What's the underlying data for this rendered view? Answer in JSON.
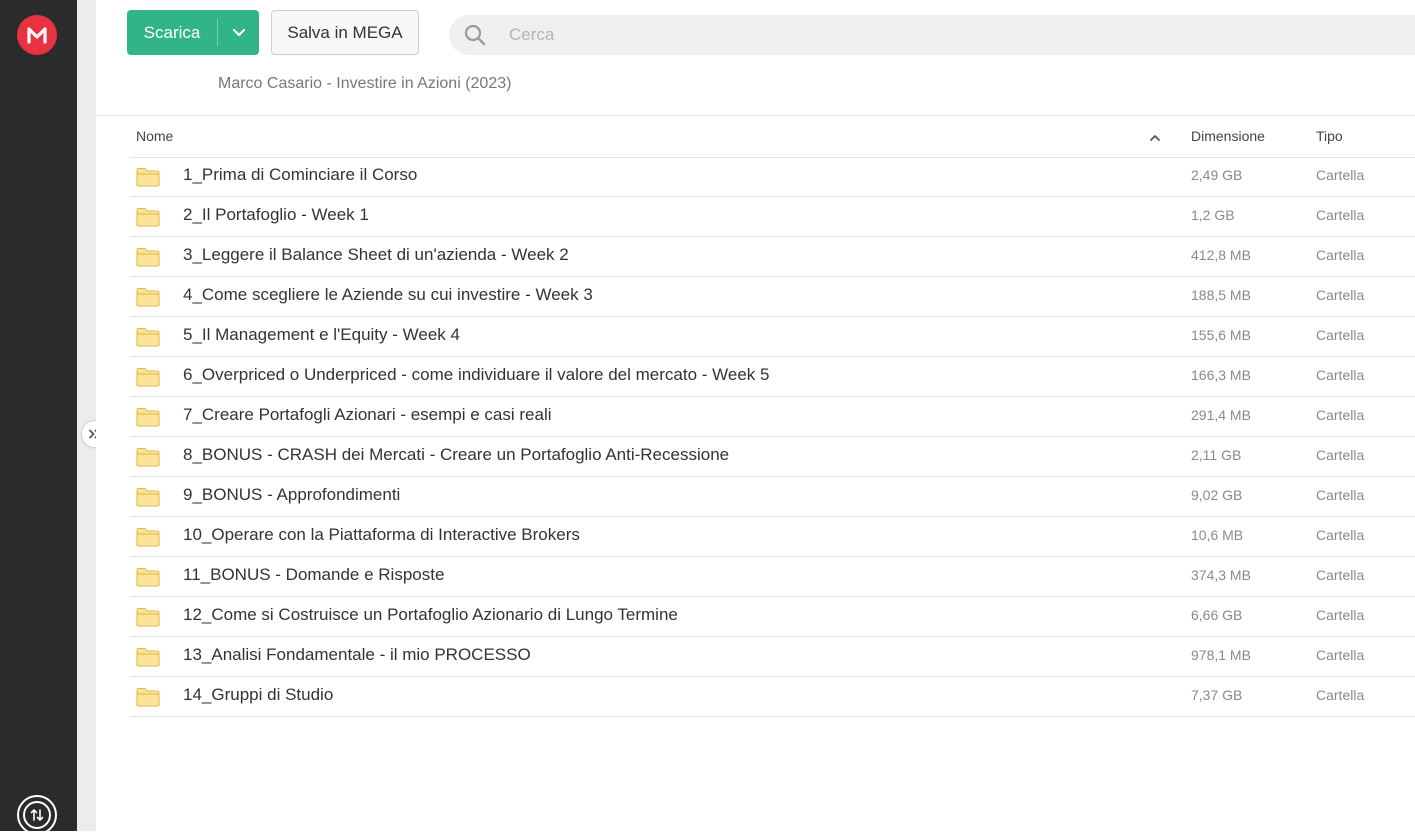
{
  "app": {
    "logo_icon": "mega-logo-icon",
    "brand_color": "#e8323f",
    "accent_color": "#31b487"
  },
  "toolbar": {
    "download_label": "Scarica",
    "save_label": "Salva in MEGA",
    "search_placeholder": "Cerca"
  },
  "breadcrumb": {
    "path": "Marco Casario - Investire in Azioni (2023)"
  },
  "table": {
    "columns": {
      "name": "Nome",
      "size": "Dimensione",
      "type": "Tipo"
    },
    "sort": "name-ascending",
    "rows": [
      {
        "name": "1_Prima di Cominciare il Corso",
        "size": "2,49 GB",
        "type": "Cartella"
      },
      {
        "name": "2_Il Portafoglio - Week 1",
        "size": "1,2 GB",
        "type": "Cartella"
      },
      {
        "name": "3_Leggere il Balance Sheet di un'azienda - Week 2",
        "size": "412,8 MB",
        "type": "Cartella"
      },
      {
        "name": "4_Come scegliere le Aziende su cui investire - Week 3",
        "size": "188,5 MB",
        "type": "Cartella"
      },
      {
        "name": "5_Il Management e l'Equity - Week 4",
        "size": "155,6 MB",
        "type": "Cartella"
      },
      {
        "name": "6_Overpriced o Underpriced - come individuare il valore del mercato - Week 5",
        "size": "166,3 MB",
        "type": "Cartella"
      },
      {
        "name": "7_Creare Portafogli Azionari - esempi e casi reali",
        "size": "291,4 MB",
        "type": "Cartella"
      },
      {
        "name": "8_BONUS - CRASH dei Mercati - Creare un Portafoglio Anti-Recessione",
        "size": "2,11 GB",
        "type": "Cartella"
      },
      {
        "name": "9_BONUS - Approfondimenti",
        "size": "9,02 GB",
        "type": "Cartella"
      },
      {
        "name": "10_Operare con la Piattaforma di Interactive Brokers",
        "size": "10,6 MB",
        "type": "Cartella"
      },
      {
        "name": "11_BONUS - Domande e Risposte",
        "size": "374,3 MB",
        "type": "Cartella"
      },
      {
        "name": "12_Come si Costruisce un Portafoglio Azionario di Lungo Termine",
        "size": "6,66 GB",
        "type": "Cartella"
      },
      {
        "name": "13_Analisi Fondamentale - il mio PROCESSO",
        "size": "978,1 MB",
        "type": "Cartella"
      },
      {
        "name": "14_Gruppi di Studio",
        "size": "7,37 GB",
        "type": "Cartella"
      }
    ]
  }
}
